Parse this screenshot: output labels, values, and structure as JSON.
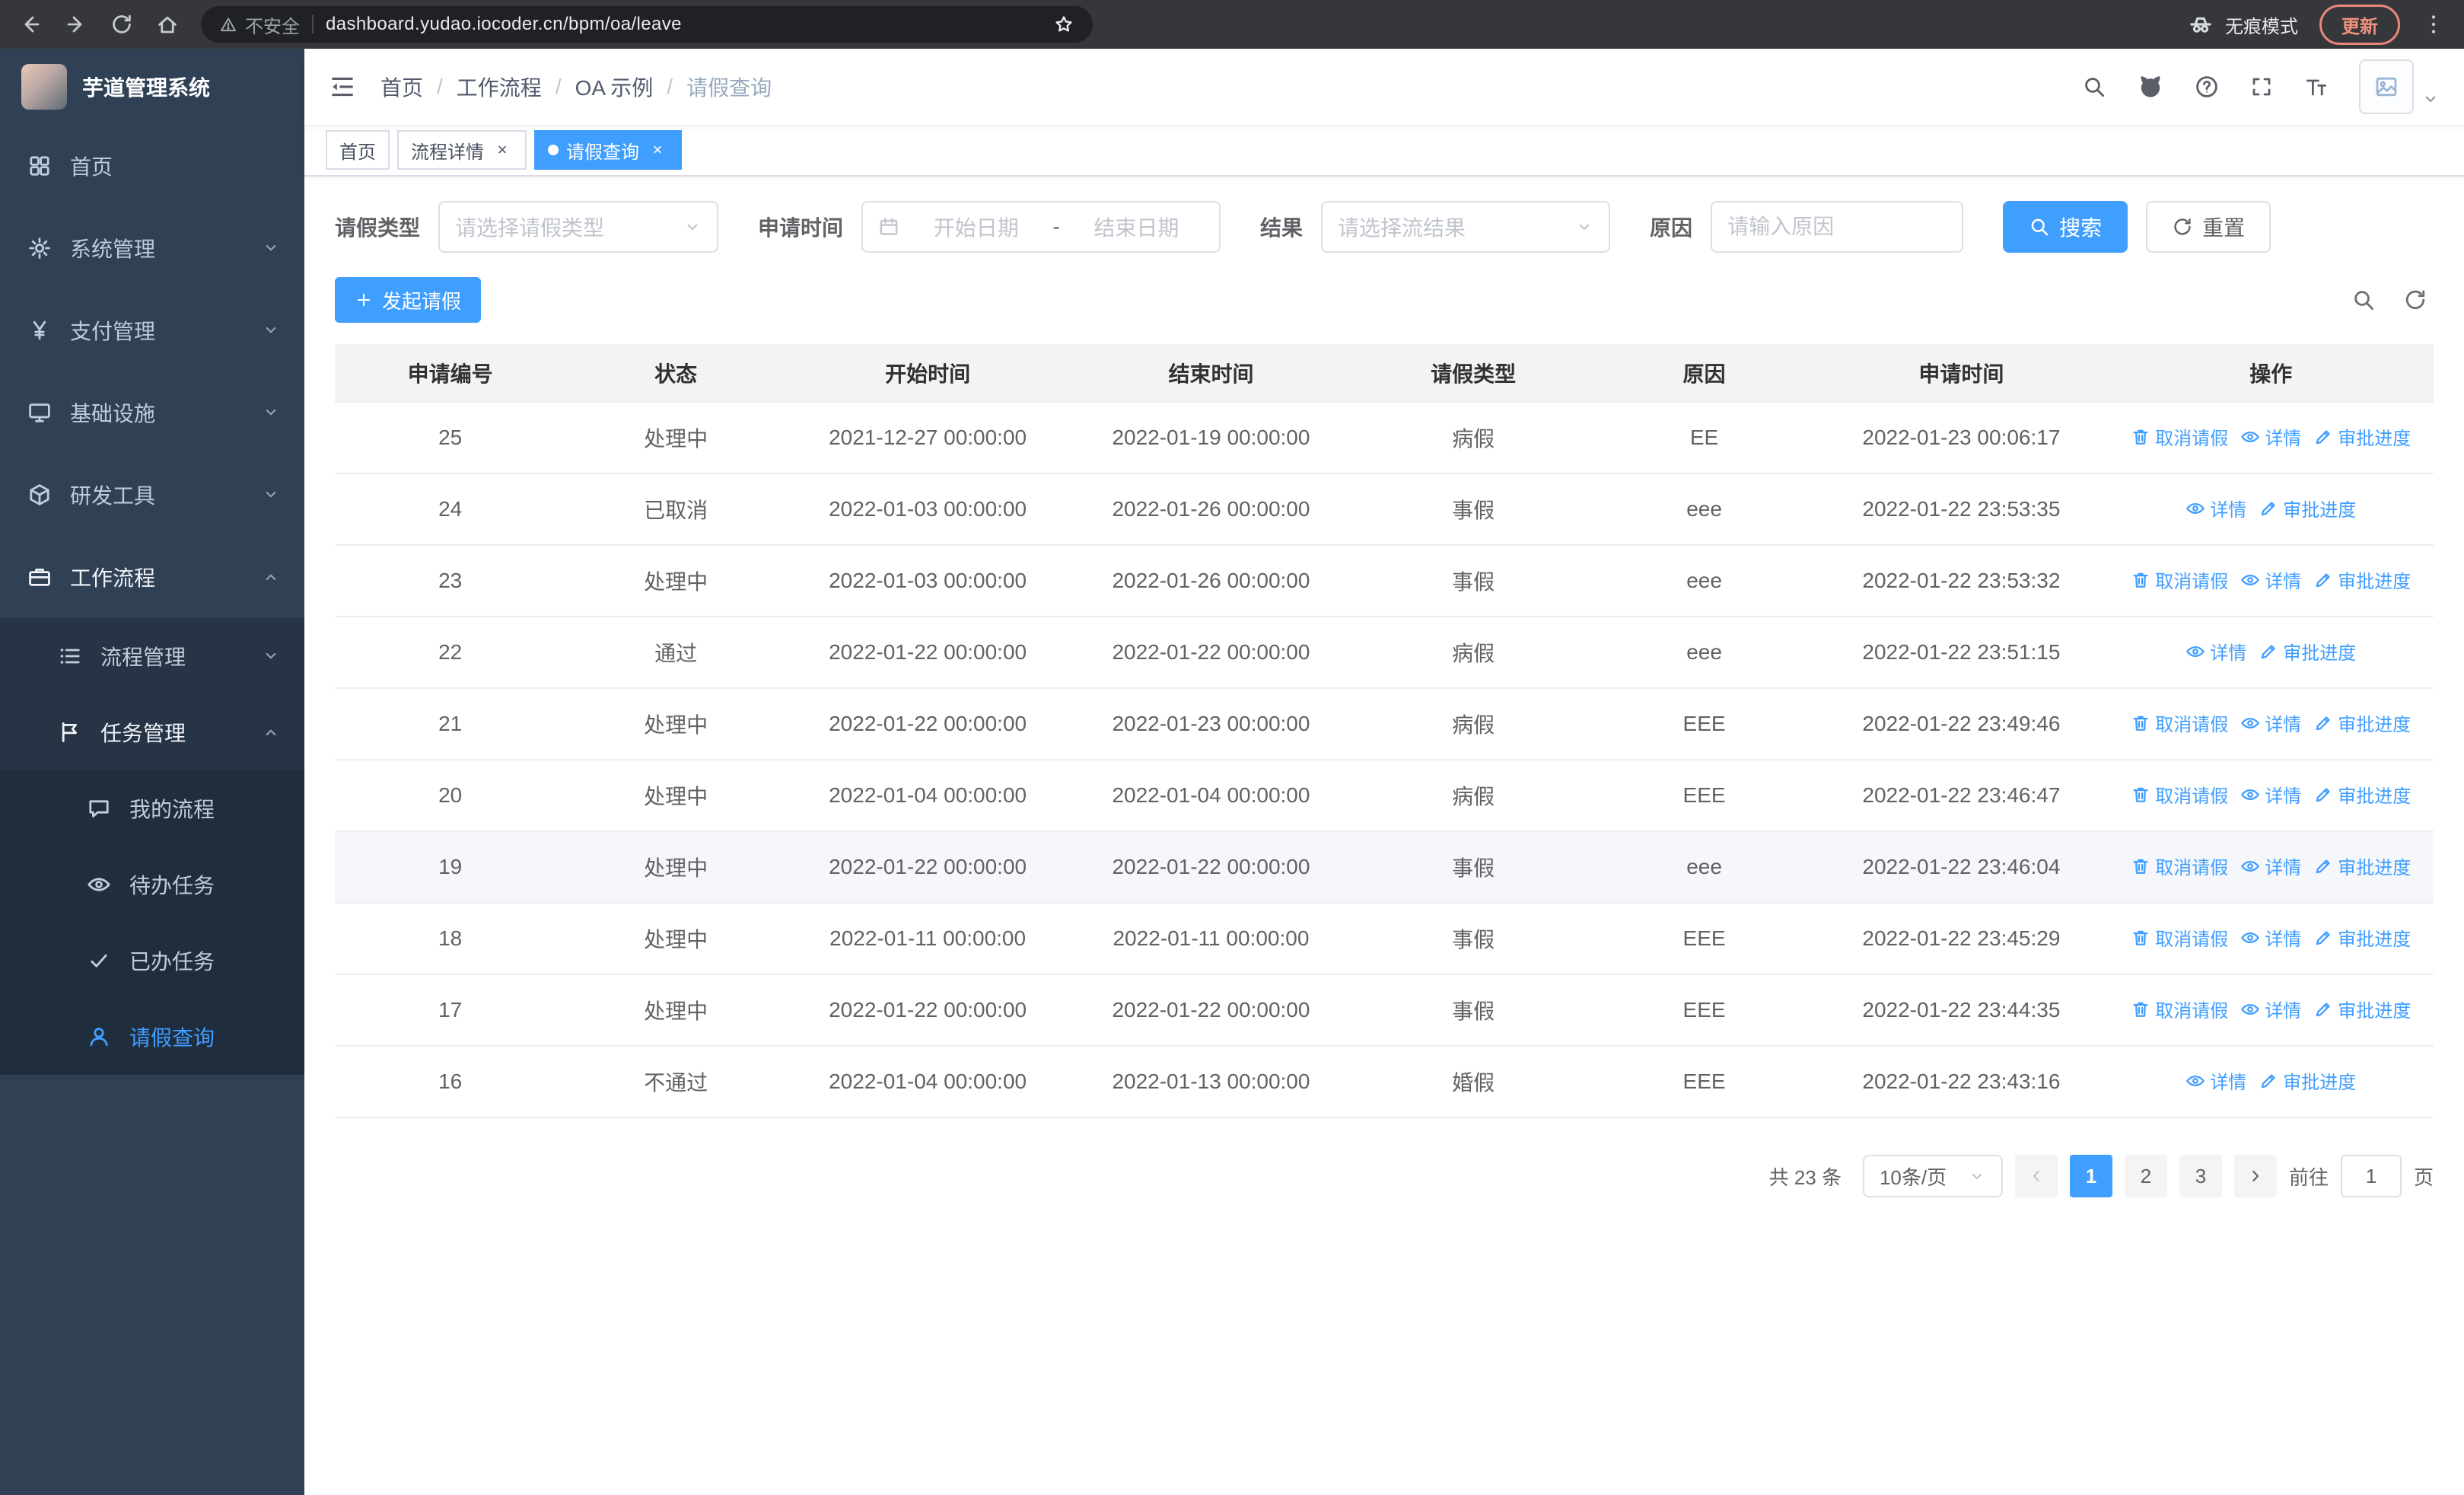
{
  "browser": {
    "security_label": "不安全",
    "url": "dashboard.yudao.iocoder.cn/bpm/oa/leave",
    "incognito_label": "无痕模式",
    "update_label": "更新"
  },
  "sidebar": {
    "logo_title": "芋道管理系统",
    "items": [
      {
        "key": "home",
        "label": "首页",
        "icon": "dashboard",
        "level": 1
      },
      {
        "key": "system-management",
        "label": "系统管理",
        "icon": "gear",
        "level": 1,
        "chevron": "down"
      },
      {
        "key": "payment-management",
        "label": "支付管理",
        "icon": "yen",
        "level": 1,
        "chevron": "down"
      },
      {
        "key": "infrastructure",
        "label": "基础设施",
        "icon": "monitor",
        "level": 1,
        "chevron": "down"
      },
      {
        "key": "dev-tools",
        "label": "研发工具",
        "icon": "cube",
        "level": 1,
        "chevron": "down"
      },
      {
        "key": "workflow",
        "label": "工作流程",
        "icon": "briefcase",
        "level": 1,
        "chevron": "up",
        "open": true
      },
      {
        "key": "process-management",
        "label": "流程管理",
        "icon": "list",
        "level": 2,
        "chevron": "down"
      },
      {
        "key": "task-management",
        "label": "任务管理",
        "icon": "flag",
        "level": 2,
        "chevron": "up",
        "open": true
      },
      {
        "key": "my-processes",
        "label": "我的流程",
        "icon": "chat",
        "level": 3
      },
      {
        "key": "todo-tasks",
        "label": "待办任务",
        "icon": "eye",
        "level": 3
      },
      {
        "key": "done-tasks",
        "label": "已办任务",
        "icon": "check",
        "level": 3
      },
      {
        "key": "leave-query",
        "label": "请假查询",
        "icon": "person",
        "level": 3,
        "active": true
      }
    ]
  },
  "navbar": {
    "breadcrumbs": [
      "首页",
      "工作流程",
      "OA 示例",
      "请假查询"
    ],
    "separator": "/"
  },
  "tags_bar": {
    "close_glyph": "×",
    "tags": [
      {
        "key": "home",
        "label": "首页",
        "closable": false,
        "active": false
      },
      {
        "key": "process-detail",
        "label": "流程详情",
        "closable": true,
        "active": false
      },
      {
        "key": "leave-query",
        "label": "请假查询",
        "closable": true,
        "active": true
      }
    ]
  },
  "filters": {
    "leave_type_label": "请假类型",
    "leave_type_placeholder": "请选择请假类型",
    "apply_time_label": "申请时间",
    "start_date_placeholder": "开始日期",
    "range_separator": "-",
    "end_date_placeholder": "结束日期",
    "result_label": "结果",
    "result_placeholder": "请选择流结果",
    "reason_label": "原因",
    "reason_placeholder": "请输入原因",
    "search_label": "搜索",
    "reset_label": "重置"
  },
  "toolbar": {
    "create_label": "发起请假"
  },
  "table": {
    "headers": [
      "申请编号",
      "状态",
      "开始时间",
      "结束时间",
      "请假类型",
      "原因",
      "申请时间",
      "操作"
    ],
    "action_labels": {
      "cancel": "取消请假",
      "detail": "详情",
      "progress": "审批进度"
    },
    "rows": [
      {
        "id": "25",
        "status": "处理中",
        "start": "2021-12-27 00:00:00",
        "end": "2022-01-19 00:00:00",
        "type": "病假",
        "reason": "EE",
        "applied": "2022-01-23 00:06:17",
        "actions": [
          "cancel",
          "detail",
          "progress"
        ]
      },
      {
        "id": "24",
        "status": "已取消",
        "start": "2022-01-03 00:00:00",
        "end": "2022-01-26 00:00:00",
        "type": "事假",
        "reason": "eee",
        "applied": "2022-01-22 23:53:35",
        "actions": [
          "detail",
          "progress"
        ]
      },
      {
        "id": "23",
        "status": "处理中",
        "start": "2022-01-03 00:00:00",
        "end": "2022-01-26 00:00:00",
        "type": "事假",
        "reason": "eee",
        "applied": "2022-01-22 23:53:32",
        "actions": [
          "cancel",
          "detail",
          "progress"
        ]
      },
      {
        "id": "22",
        "status": "通过",
        "start": "2022-01-22 00:00:00",
        "end": "2022-01-22 00:00:00",
        "type": "病假",
        "reason": "eee",
        "applied": "2022-01-22 23:51:15",
        "actions": [
          "detail",
          "progress"
        ]
      },
      {
        "id": "21",
        "status": "处理中",
        "start": "2022-01-22 00:00:00",
        "end": "2022-01-23 00:00:00",
        "type": "病假",
        "reason": "EEE",
        "applied": "2022-01-22 23:49:46",
        "actions": [
          "cancel",
          "detail",
          "progress"
        ]
      },
      {
        "id": "20",
        "status": "处理中",
        "start": "2022-01-04 00:00:00",
        "end": "2022-01-04 00:00:00",
        "type": "病假",
        "reason": "EEE",
        "applied": "2022-01-22 23:46:47",
        "actions": [
          "cancel",
          "detail",
          "progress"
        ]
      },
      {
        "id": "19",
        "status": "处理中",
        "start": "2022-01-22 00:00:00",
        "end": "2022-01-22 00:00:00",
        "type": "事假",
        "reason": "eee",
        "applied": "2022-01-22 23:46:04",
        "actions": [
          "cancel",
          "detail",
          "progress"
        ],
        "highlighted": true
      },
      {
        "id": "18",
        "status": "处理中",
        "start": "2022-01-11 00:00:00",
        "end": "2022-01-11 00:00:00",
        "type": "事假",
        "reason": "EEE",
        "applied": "2022-01-22 23:45:29",
        "actions": [
          "cancel",
          "detail",
          "progress"
        ]
      },
      {
        "id": "17",
        "status": "处理中",
        "start": "2022-01-22 00:00:00",
        "end": "2022-01-22 00:00:00",
        "type": "事假",
        "reason": "EEE",
        "applied": "2022-01-22 23:44:35",
        "actions": [
          "cancel",
          "detail",
          "progress"
        ]
      },
      {
        "id": "16",
        "status": "不通过",
        "start": "2022-01-04 00:00:00",
        "end": "2022-01-13 00:00:00",
        "type": "婚假",
        "reason": "EEE",
        "applied": "2022-01-22 23:43:16",
        "actions": [
          "detail",
          "progress"
        ]
      }
    ]
  },
  "pagination": {
    "total": "共 23 条",
    "page_size": "10条/页",
    "pages": [
      "1",
      "2",
      "3"
    ],
    "active_page": "1",
    "goto_label": "前往",
    "goto_value": "1",
    "unit_label": "页"
  },
  "colors": {
    "primary": "#409eff",
    "sidebar_bg": "#304156",
    "sidebar_sub_bg": "#1f2d3d"
  }
}
